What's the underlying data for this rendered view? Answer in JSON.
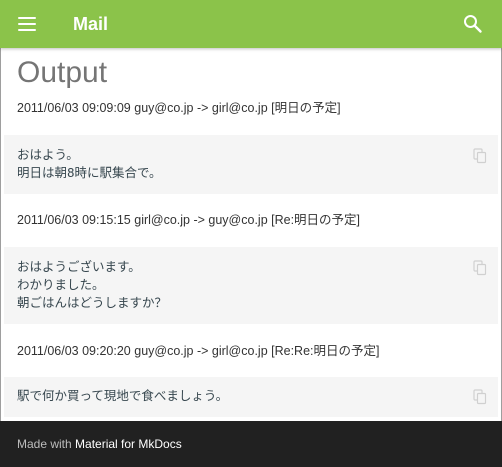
{
  "header": {
    "title": "Mail",
    "menu_icon": "menu-icon",
    "search_icon": "search-icon",
    "color": "#8bc34a"
  },
  "page": {
    "title": "Output"
  },
  "messages": [
    {
      "meta": "2011/06/03 09:09:09 guy@co.jp -> girl@co.jp [明日の予定]",
      "body": "おはよう。\n明日は朝8時に駅集合で。"
    },
    {
      "meta": "2011/06/03 09:15:15 girl@co.jp -> guy@co.jp [Re:明日の予定]",
      "body": "おはようございます。\nわかりました。\n朝ごはんはどうしますか？"
    },
    {
      "meta": "2011/06/03 09:20:20 guy@co.jp -> girl@co.jp [Re:Re:明日の予定]",
      "body": "駅で何か買って現地で食べましょう。"
    }
  ],
  "footer": {
    "made_with": "Made with ",
    "link_text": "Material for MkDocs",
    "background": "#212121"
  }
}
